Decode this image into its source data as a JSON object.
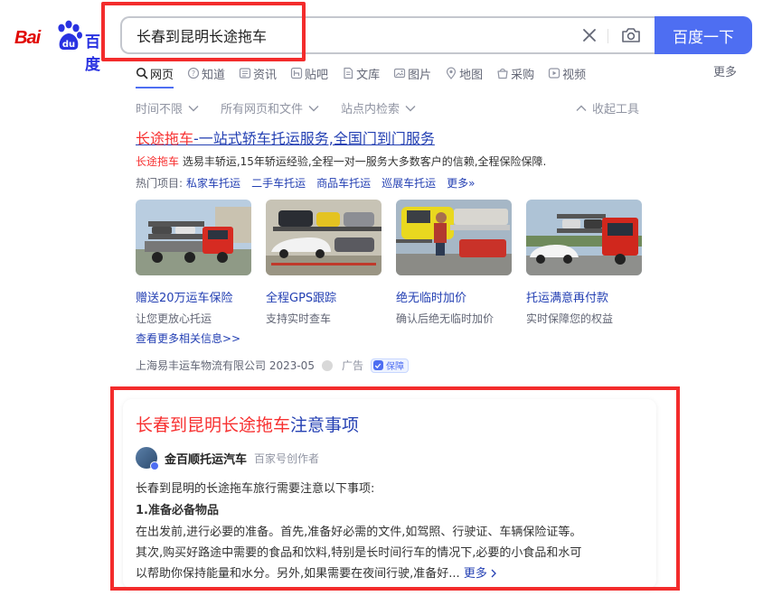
{
  "logo": {
    "text_left": "Bai",
    "text_right": "百度"
  },
  "search": {
    "query": "长春到昆明长途拖车",
    "button_label": "百度一下"
  },
  "tabs": [
    {
      "label": "网页",
      "icon": "search-icon",
      "active": true
    },
    {
      "label": "知道",
      "icon": "question-icon",
      "active": false
    },
    {
      "label": "资讯",
      "icon": "news-icon",
      "active": false
    },
    {
      "label": "贴吧",
      "icon": "tieba-icon",
      "active": false
    },
    {
      "label": "文库",
      "icon": "doc-icon",
      "active": false
    },
    {
      "label": "图片",
      "icon": "image-icon",
      "active": false
    },
    {
      "label": "地图",
      "icon": "map-pin-icon",
      "active": false
    },
    {
      "label": "采购",
      "icon": "shop-icon",
      "active": false
    },
    {
      "label": "视频",
      "icon": "video-icon",
      "active": false
    }
  ],
  "tab_more": "更多",
  "filters": [
    "时间不限",
    "所有网页和文件",
    "站点内检索"
  ],
  "collapse_tools": "收起工具",
  "ad": {
    "title_hl": "长途拖车",
    "title_rest": "-一站式轿车托运服务,全国门到门服务",
    "desc_hl": "长途拖车",
    "desc_rest": " 选易丰轿运,15年轿运经验,全程一对一服务大多数客户的信赖,全程保险保障.",
    "hot_label": "热门项目:",
    "hot_links": [
      "私家车托运",
      "二手车托运",
      "商品车托运",
      "巡展车托运",
      "更多»"
    ],
    "cards": [
      {
        "title": "赠送20万运车保险",
        "subtitle": "让您更放心托运"
      },
      {
        "title": "全程GPS跟踪",
        "subtitle": "支持实时查车"
      },
      {
        "title": "绝无临时加价",
        "subtitle": "确认后绝无临时加价"
      },
      {
        "title": "托运满意再付款",
        "subtitle": "实时保障您的权益"
      }
    ],
    "more_info": "查看更多相关信息>>",
    "source": "上海易丰运车物流有限公司 2023-05",
    "ad_tag": "广告",
    "badge": "保障"
  },
  "article": {
    "title_hl": "长春到昆明长途拖车",
    "title_rest": "注意事项",
    "author": "金百顺托运汽车",
    "author_role": "百家号创作者",
    "line1": "长春到昆明的长途拖车旅行需要注意以下事项:",
    "line2": "1.准备必备物品",
    "line3": "在出发前,进行必要的准备。首先,准备好必需的文件,如驾照、行驶证、车辆保险证等。",
    "line4": "其次,购买好路途中需要的食品和饮料,特别是长时间行车的情况下,必要的小食品和水可",
    "line5": "以帮助你保持能量和水分。另外,如果需要在夜间行驶,准备好...",
    "more": "更多"
  },
  "colors": {
    "accent": "#4e6ef2",
    "link": "#2440b3",
    "highlight": "#f73131",
    "annotation_box": "#f32c2c"
  }
}
